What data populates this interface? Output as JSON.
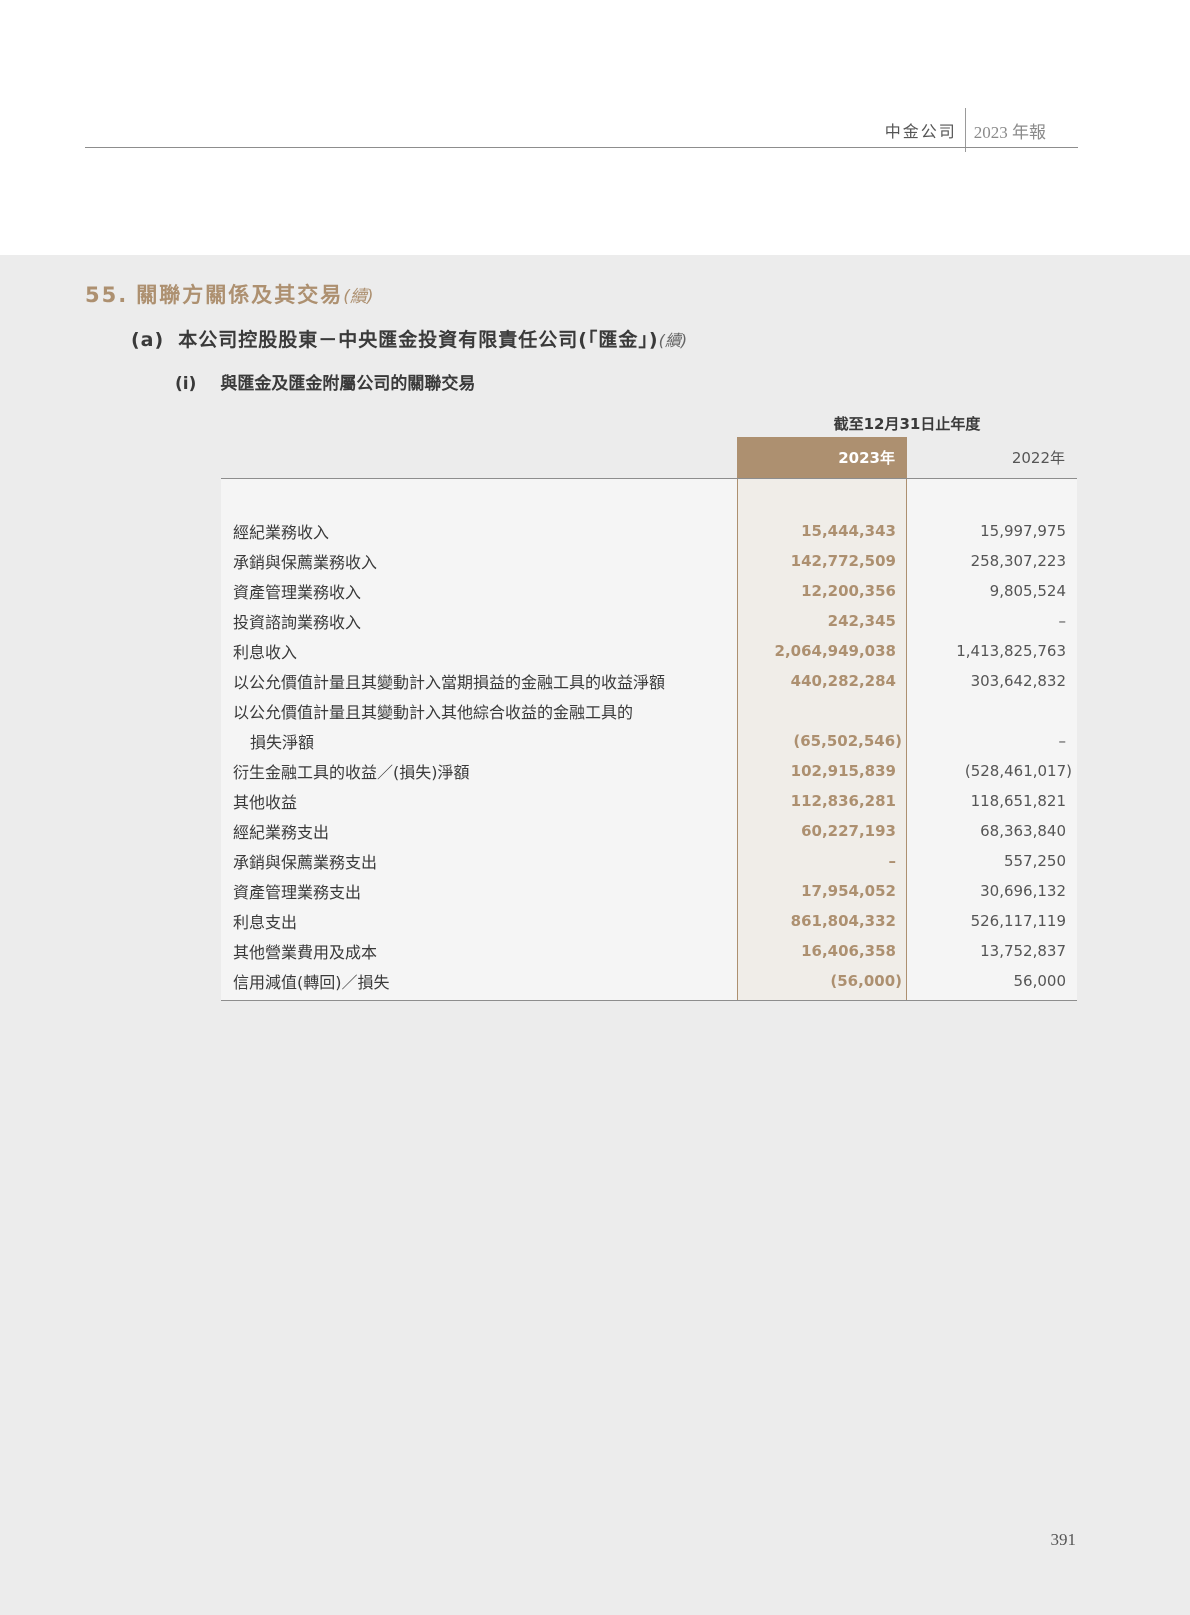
{
  "header": {
    "company": "中金公司",
    "report": "2023 年報"
  },
  "section": {
    "number": "55.",
    "title": "關聯方關係及其交易",
    "continued": "(續)"
  },
  "subsection": {
    "label": "(a)",
    "title": "本公司控股股東－中央匯金投資有限責任公司(「匯金」)",
    "continued": "(續)"
  },
  "subsubsection": {
    "label": "(i)",
    "title": "與匯金及匯金附屬公司的關聯交易"
  },
  "table": {
    "period_label": "截至12月31日止年度",
    "col_2023": "2023年",
    "col_2022": "2022年",
    "rows": [
      {
        "label": "經紀業務收入",
        "v2023": "15,444,343",
        "v2022": "15,997,975"
      },
      {
        "label": "承銷與保薦業務收入",
        "v2023": "142,772,509",
        "v2022": "258,307,223"
      },
      {
        "label": "資產管理業務收入",
        "v2023": "12,200,356",
        "v2022": "9,805,524"
      },
      {
        "label": "投資諮詢業務收入",
        "v2023": "242,345",
        "v2022": "–"
      },
      {
        "label": "利息收入",
        "v2023": "2,064,949,038",
        "v2022": "1,413,825,763"
      },
      {
        "label": "以公允價值計量且其變動計入當期損益的金融工具的收益淨額",
        "v2023": "440,282,284",
        "v2022": "303,642,832"
      },
      {
        "label": "以公允價值計量且其變動計入其他綜合收益的金融工具的",
        "v2023": "",
        "v2022": ""
      },
      {
        "label": "損失淨額",
        "v2023": "(65,502,546)",
        "v2022": "–"
      },
      {
        "label": "衍生金融工具的收益／(損失)淨額",
        "v2023": "102,915,839",
        "v2022": "(528,461,017)"
      },
      {
        "label": "其他收益",
        "v2023": "112,836,281",
        "v2022": "118,651,821"
      },
      {
        "label": "經紀業務支出",
        "v2023": "60,227,193",
        "v2022": "68,363,840"
      },
      {
        "label": "承銷與保薦業務支出",
        "v2023": "–",
        "v2022": "557,250"
      },
      {
        "label": "資產管理業務支出",
        "v2023": "17,954,052",
        "v2022": "30,696,132"
      },
      {
        "label": "利息支出",
        "v2023": "861,804,332",
        "v2022": "526,117,119"
      },
      {
        "label": "其他營業費用及成本",
        "v2023": "16,406,358",
        "v2022": "13,752,837"
      },
      {
        "label": "信用減值(轉回)／損失",
        "v2023": "(56,000)",
        "v2022": "56,000"
      }
    ]
  },
  "page_number": "391"
}
